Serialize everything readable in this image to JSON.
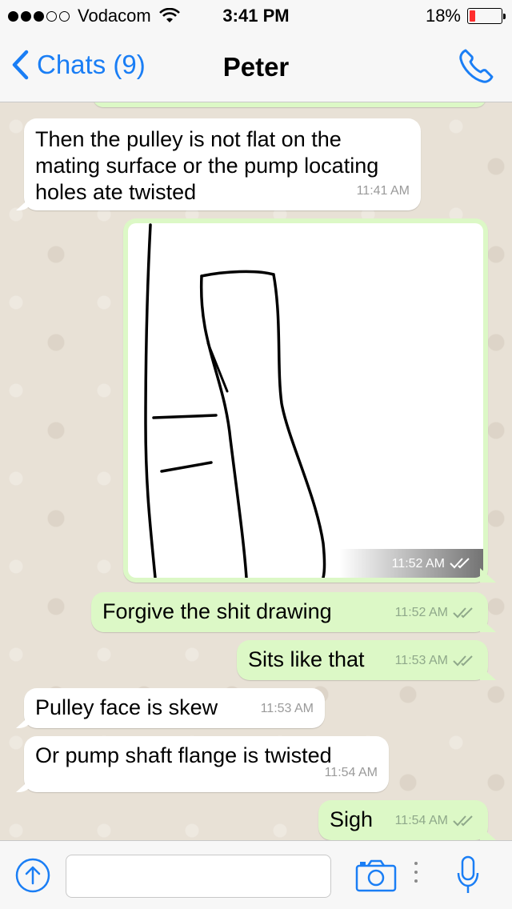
{
  "status": {
    "carrier": "Vodacom",
    "time": "3:41 PM",
    "battery_pct": "18%",
    "battery_level": 0.18,
    "signal_bars": 3,
    "wifi_icon": "wifi-icon"
  },
  "nav": {
    "back_label": "Chats (9)",
    "title": "Peter",
    "call_icon": "phone-icon"
  },
  "messages": [
    {
      "dir": "in",
      "text": "Then the pulley is not flat on the mating surface or the pump locating holes ate twisted",
      "time": "11:41 AM"
    },
    {
      "dir": "out",
      "type": "image",
      "time": "11:52 AM",
      "ticks": "double-check-icon"
    },
    {
      "dir": "out",
      "text": "Forgive the shit drawing",
      "time": "11:52 AM",
      "ticks": "double-check-icon"
    },
    {
      "dir": "out",
      "text": "Sits like that",
      "time": "11:53 AM",
      "ticks": "double-check-icon"
    },
    {
      "dir": "in",
      "text": "Pulley face is skew",
      "time": "11:53 AM"
    },
    {
      "dir": "in",
      "text": "Or pump shaft flange is twisted",
      "time": "11:54 AM"
    },
    {
      "dir": "out",
      "text": "Sigh",
      "time": "11:54 AM",
      "ticks": "double-check-icon"
    }
  ],
  "input": {
    "value": "",
    "placeholder": ""
  },
  "colors": {
    "accent": "#1a7ef5",
    "outgoing": "#dcf8c6",
    "incoming": "#ffffff",
    "chat_bg": "#e8e1d6"
  }
}
